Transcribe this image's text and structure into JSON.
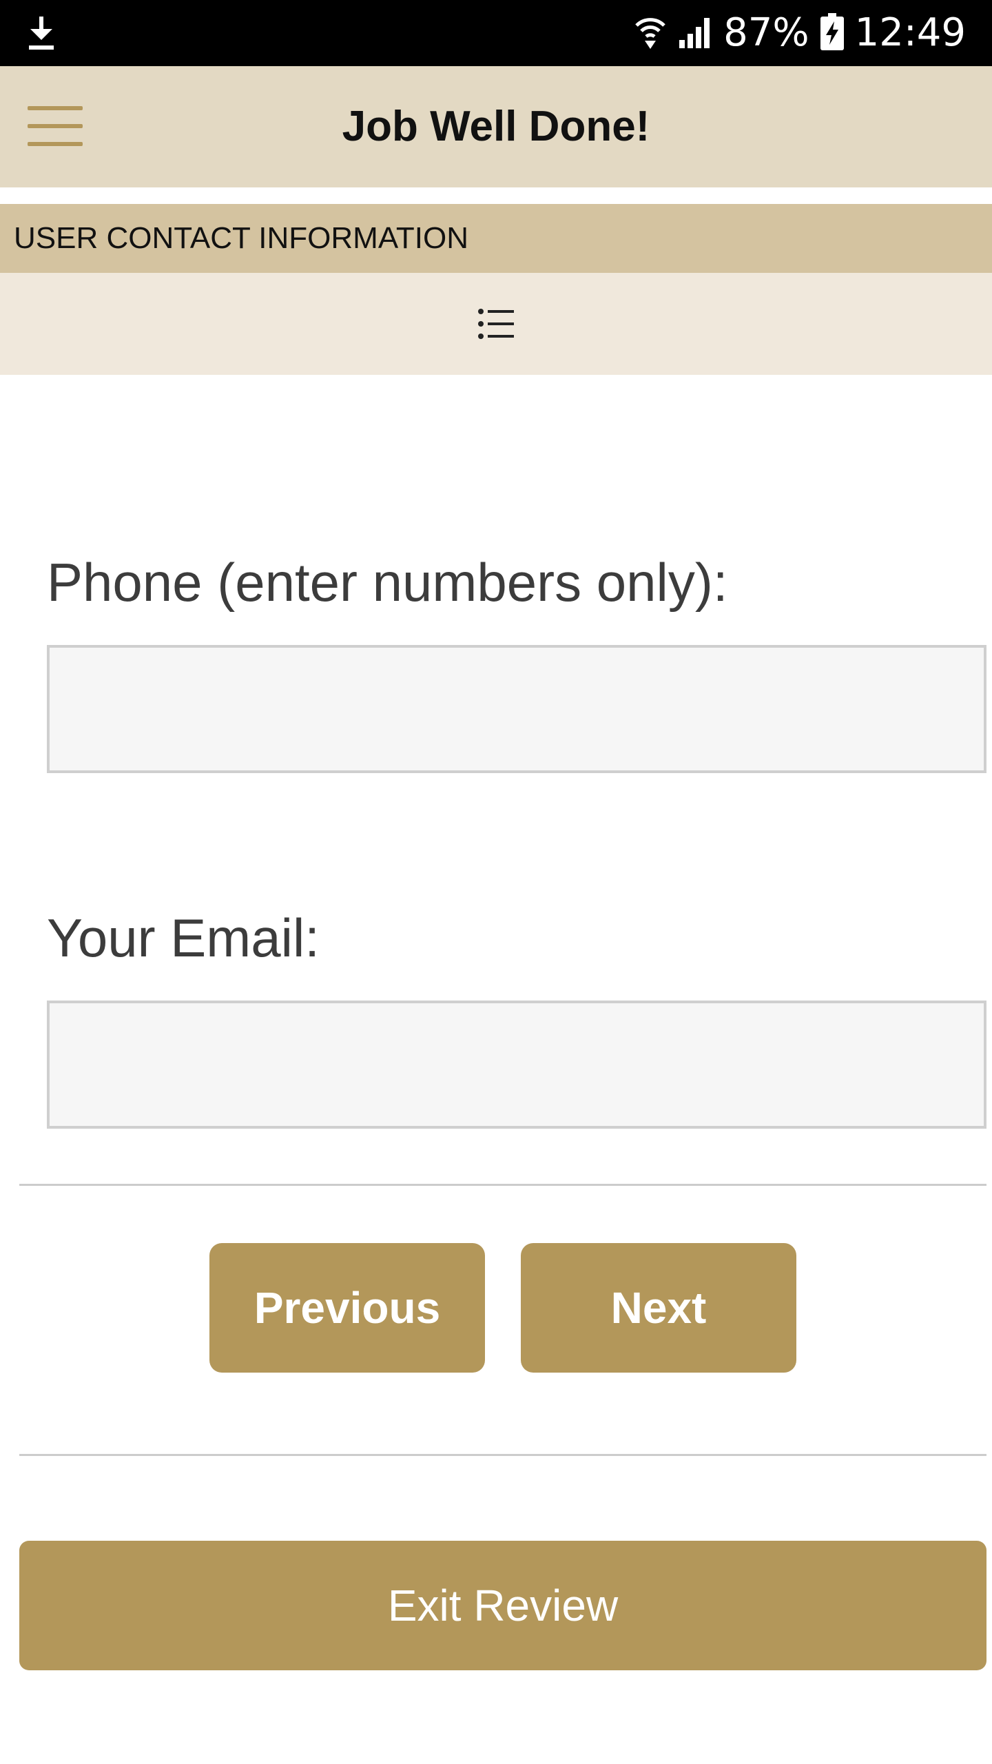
{
  "status_bar": {
    "battery_percent": "87%",
    "time": "12:49",
    "icons": [
      "download-icon",
      "wifi-icon",
      "signal-icon",
      "battery-charging-icon"
    ]
  },
  "header": {
    "title": "Job Well Done!",
    "menu_icon": "hamburger-menu-icon"
  },
  "section": {
    "title": "USER CONTACT INFORMATION",
    "toc_icon": "list-icon"
  },
  "form": {
    "phone_label": "Phone (enter numbers only):",
    "phone_value": "",
    "email_label": "Your Email:",
    "email_value": ""
  },
  "navigation": {
    "previous_label": "Previous",
    "next_label": "Next",
    "exit_label": "Exit Review"
  },
  "colors": {
    "status_bar": "#000000",
    "header_bg": "#e3d9c3",
    "section_bg": "#d4c3a0",
    "toc_bg": "#f0e8dc",
    "accent": "#b3975a",
    "input_bg": "#f6f6f6"
  }
}
